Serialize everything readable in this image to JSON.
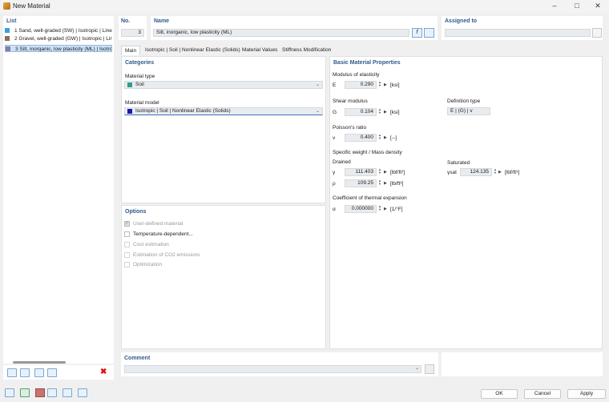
{
  "window": {
    "title": "New Material"
  },
  "list": {
    "header": "List",
    "items": [
      {
        "label": "1  Sand, well-graded (SW) | Isotropic | Linear",
        "color": "#3aa0e0"
      },
      {
        "label": "2  Gravel, well-graded (GW) | Isotropic | Linear",
        "color": "#8d6e52"
      },
      {
        "label": "3  Silt, inorganic, low plasticity (ML) | Isotropic",
        "color": "#8a7ba0"
      }
    ]
  },
  "no": {
    "label": "No.",
    "value": "3"
  },
  "name": {
    "label": "Name",
    "value": "Silt, inorganic, low plasticity (ML)"
  },
  "assigned": {
    "label": "Assigned to",
    "value": ""
  },
  "tabs": [
    {
      "label": "Main"
    },
    {
      "label": "Isotropic | Soil | Nonlinear Elastic (Solids)"
    },
    {
      "label": "Material Values"
    },
    {
      "label": "Stiffness Modification"
    }
  ],
  "categories": {
    "header": "Categories",
    "material_type_label": "Material type",
    "material_type_value": "Soil",
    "material_type_color": "#2e9e8f",
    "material_model_label": "Material model",
    "material_model_value": "Isotropic | Soil | Nonlinear Elastic (Solids)",
    "material_model_color": "#1a1aa8"
  },
  "options": {
    "header": "Options",
    "items": [
      {
        "label": "User-defined material",
        "checked": true,
        "enabled": false
      },
      {
        "label": "Temperature-dependent...",
        "checked": false,
        "enabled": true
      },
      {
        "label": "Cost estimation",
        "checked": false,
        "enabled": false
      },
      {
        "label": "Estimation of CO2 emissions",
        "checked": false,
        "enabled": false
      },
      {
        "label": "Optimization",
        "checked": false,
        "enabled": false
      }
    ]
  },
  "basic": {
    "header": "Basic Material Properties",
    "modulus_label": "Modulus of elasticity",
    "E_sym": "E",
    "E_val": "0.290",
    "E_unit": "[ksi]",
    "shear_label": "Shear modulus",
    "G_sym": "G",
    "G_val": "0.104",
    "G_unit": "[ksi]",
    "def_type_label": "Definition type",
    "def_type_val": "E | (G) | v",
    "poisson_label": "Poisson's ratio",
    "v_sym": "v",
    "v_val": "0.400",
    "v_unit": "[--]",
    "weight_label": "Specific weight / Mass density",
    "drained_label": "Drained",
    "saturated_label": "Saturated",
    "gamma_sym": "γ",
    "gamma_val": "111.403",
    "gamma_unit": "[lbf/ft³]",
    "rho_sym": "ρ",
    "rho_val": "109.25",
    "rho_unit": "[lb/ft³]",
    "gsat_sym": "γsat",
    "gsat_val": "124.135",
    "gsat_unit": "[lbf/ft³]",
    "thermal_label": "Coefficient of thermal expansion",
    "alpha_sym": "α",
    "alpha_val": "0.000000",
    "alpha_unit": "[1/°F]"
  },
  "comment": {
    "label": "Comment",
    "value": ""
  },
  "buttons": {
    "ok": "OK",
    "cancel": "Cancel",
    "apply": "Apply"
  }
}
